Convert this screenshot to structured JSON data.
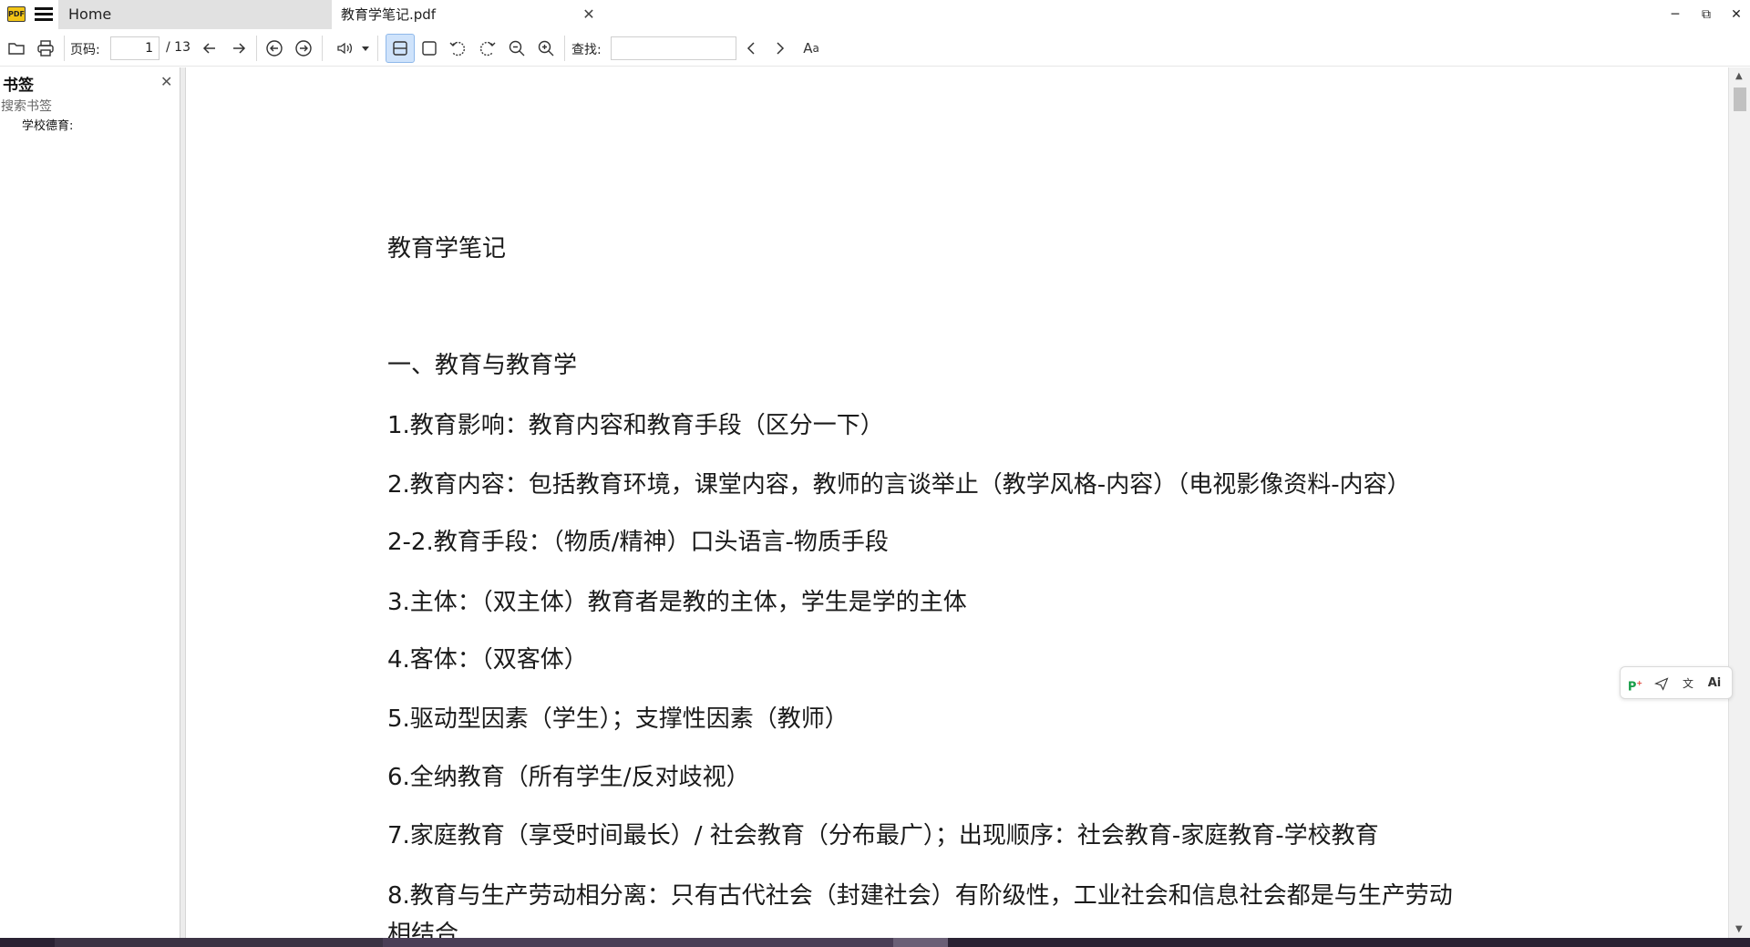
{
  "titlebar": {
    "logo_text": "PDF",
    "home_tab": "Home",
    "doc_tab": "教育学笔记.pdf",
    "tab_close": "✕",
    "minimize": "─",
    "restore": "⧉",
    "close": "✕"
  },
  "toolbar": {
    "page_label": "页码:",
    "page_current": "1",
    "page_total": "/ 13",
    "find_label": "查找:",
    "find_value": "",
    "icons": [
      "open-folder-icon",
      "print-icon",
      "arrow-left-icon",
      "arrow-right-icon",
      "circle-back-icon",
      "circle-forward-icon",
      "speaker-icon",
      "dropdown-icon",
      "continuous-page-icon",
      "single-page-icon",
      "rotate-left-icon",
      "rotate-right-icon",
      "zoom-out-icon",
      "zoom-in-icon",
      "prev-result-icon",
      "next-result-icon",
      "font-case-icon"
    ]
  },
  "sidebar": {
    "title": "书签",
    "close": "✕",
    "search_placeholder": "搜索书签",
    "items": [
      {
        "label": "学校德育:"
      }
    ]
  },
  "document": {
    "lines": [
      "教育学笔记",
      "一、教育与教育学",
      "1.教育影响：教育内容和教育手段（区分一下）",
      "2.教育内容：包括教育环境，课堂内容，教师的言谈举止（教学风格-内容）（电视影像资料-内容）",
      "2-2.教育手段：（物质/精神）口头语言-物质手段",
      "3.主体：（双主体）教育者是教的主体，学生是学的主体",
      "4.客体：（双客体）",
      "5.驱动型因素（学生）；支撑性因素（教师）",
      "6.全纳教育（所有学生/反对歧视）",
      "7.家庭教育（享受时间最长）/ 社会教育（分布最广）；出现顺序：社会教育-家庭教育-学校教育",
      "8.教育与生产劳动相分离：只有古代社会（封建社会）有阶级性，工业社会和信息社会都是与生产劳动",
      "相结合"
    ]
  },
  "floatbar": {
    "icons": [
      "pin-plus-icon",
      "send-icon",
      "translate-icon",
      "ai-icon"
    ],
    "ai_label": "Ai"
  },
  "colors": {
    "tab_inactive": "#e1e1e1",
    "toolbar_active": "#cfe3fb",
    "logo": "#f2c516",
    "float_accent": "#1a9e4a"
  }
}
